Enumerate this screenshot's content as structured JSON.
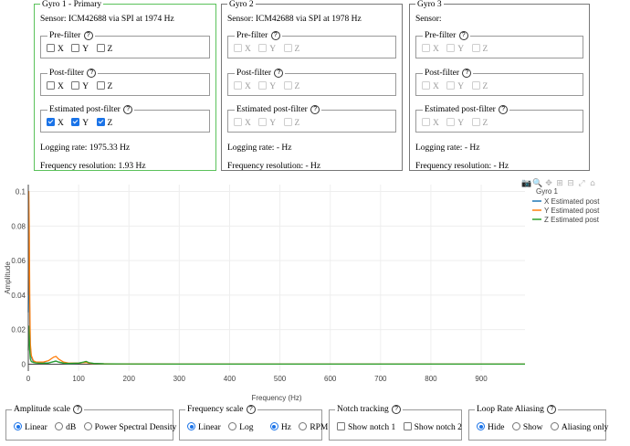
{
  "gyros": [
    {
      "title": "Gyro 1 - Primary",
      "sensor": "Sensor: ICM42688 via SPI at 1974 Hz",
      "prefilter": {
        "label": "Pre-filter",
        "x": false,
        "y": false,
        "z": false
      },
      "postfilter": {
        "label": "Post-filter",
        "x": false,
        "y": false,
        "z": false
      },
      "estimated": {
        "label": "Estimated post-filter",
        "x": true,
        "y": true,
        "z": true
      },
      "logging_rate": "Logging rate: 1975.33 Hz",
      "frequency_resolution": "Frequency resolution: 1.93 Hz"
    },
    {
      "title": "Gyro 2",
      "sensor": "Sensor: ICM42688 via SPI at 1978 Hz",
      "prefilter": {
        "label": "Pre-filter"
      },
      "postfilter": {
        "label": "Post-filter"
      },
      "estimated": {
        "label": "Estimated post-filter"
      },
      "logging_rate": "Logging rate: - Hz",
      "frequency_resolution": "Frequency resolution: - Hz"
    },
    {
      "title": "Gyro 3",
      "sensor": "Sensor:",
      "prefilter": {
        "label": "Pre-filter"
      },
      "postfilter": {
        "label": "Post-filter"
      },
      "estimated": {
        "label": "Estimated post-filter"
      },
      "logging_rate": "Logging rate: - Hz",
      "frequency_resolution": "Frequency resolution: - Hz"
    }
  ],
  "axis_labels": {
    "x": "X",
    "y": "Y",
    "z": "Z"
  },
  "help_glyph": "?",
  "modebar_icons": [
    "camera-icon",
    "zoom-icon",
    "pan-icon",
    "zoom-in-icon",
    "zoom-out-icon",
    "autoscale-icon",
    "reset-axes-icon"
  ],
  "chart_data": {
    "type": "line",
    "xlabel": "Frequency (Hz)",
    "ylabel": "Amplitude",
    "xlim": [
      0,
      987
    ],
    "ylim": [
      -0.004,
      0.104
    ],
    "x_ticks": [
      0,
      100,
      200,
      300,
      400,
      500,
      600,
      700,
      800,
      900
    ],
    "y_ticks": [
      0,
      0.02,
      0.04,
      0.06,
      0.08,
      0.1
    ],
    "y_tick_labels": [
      "0",
      "0.02",
      "0.04",
      "0.06",
      "0.08",
      "0.1"
    ],
    "grid": true,
    "legend_title": "Gyro 1",
    "legend_position": "top-right",
    "series": [
      {
        "name": "X Estimated post",
        "color": "#1f77b4",
        "x": [
          0,
          1,
          2,
          3,
          4,
          6,
          10,
          15,
          20,
          30,
          40,
          50,
          55,
          60,
          70,
          80,
          100,
          110,
          115,
          120,
          130,
          150,
          200,
          300,
          987
        ],
        "y": [
          0.03,
          0.068,
          0.055,
          0.025,
          0.01,
          0.004,
          0.0015,
          0.001,
          0.0008,
          0.0007,
          0.0007,
          0.0014,
          0.0018,
          0.0012,
          0.0006,
          0.0004,
          0.0006,
          0.001,
          0.0012,
          0.0007,
          0.0004,
          0.0002,
          0.0001,
          5e-05,
          3e-05
        ]
      },
      {
        "name": "Y Estimated post",
        "color": "#ff7f0e",
        "x": [
          0,
          1,
          2,
          3,
          4,
          6,
          10,
          15,
          20,
          30,
          40,
          50,
          55,
          60,
          70,
          80,
          100,
          110,
          115,
          120,
          130,
          150,
          200,
          300,
          987
        ],
        "y": [
          0.04,
          0.1,
          0.075,
          0.035,
          0.012,
          0.005,
          0.002,
          0.0013,
          0.0012,
          0.0012,
          0.002,
          0.004,
          0.0045,
          0.003,
          0.0012,
          0.0006,
          0.0006,
          0.0009,
          0.001,
          0.0006,
          0.0003,
          0.0002,
          0.0001,
          5e-05,
          3e-05
        ]
      },
      {
        "name": "Z Estimated post",
        "color": "#2ca02c",
        "x": [
          0,
          1,
          2,
          3,
          4,
          6,
          10,
          15,
          20,
          30,
          40,
          50,
          55,
          60,
          70,
          80,
          100,
          110,
          115,
          120,
          130,
          150,
          200,
          300,
          987
        ],
        "y": [
          0.008,
          0.022,
          0.016,
          0.007,
          0.003,
          0.0015,
          0.001,
          0.0007,
          0.0006,
          0.0005,
          0.0006,
          0.0014,
          0.0018,
          0.0012,
          0.0006,
          0.0004,
          0.0006,
          0.0012,
          0.0016,
          0.0009,
          0.0004,
          0.0002,
          0.0001,
          5e-05,
          3e-05
        ]
      }
    ]
  },
  "controls": {
    "amplitude": {
      "legend": "Amplitude scale",
      "options": [
        "Linear",
        "dB",
        "Power Spectral Density"
      ],
      "selected": "Linear"
    },
    "frequency": {
      "legend": "Frequency scale",
      "scale_options": [
        "Linear",
        "Log"
      ],
      "scale_selected": "Linear",
      "unit_options": [
        "Hz",
        "RPM"
      ],
      "unit_selected": "Hz"
    },
    "notch": {
      "legend": "Notch tracking",
      "options": [
        "Show notch 1",
        "Show notch 2"
      ]
    },
    "aliasing": {
      "legend": "Loop Rate Aliasing",
      "options": [
        "Hide",
        "Show",
        "Aliasing only"
      ],
      "selected": "Hide"
    }
  }
}
